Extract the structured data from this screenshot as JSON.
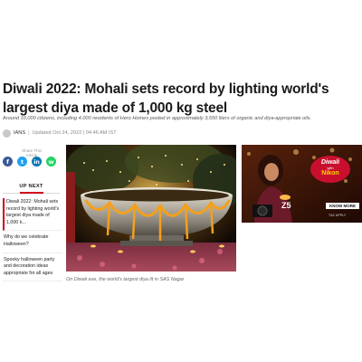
{
  "article": {
    "headline": "Diwali 2022: Mohali sets record by lighting world's largest diya made of 1,000 kg steel",
    "summary": "Around 10,000 citizens, including 4,000 residents of Hero Homes pooled in approximately 3,550 liters of organic and diya-appropriate oils.",
    "author": "IANS",
    "separator": "|",
    "updated": "Updated Oct 24, 2022 | 04:46 AM IST",
    "image_caption": "On Diwali eve, the world's largest diya lit in SAS Nagar"
  },
  "share": {
    "label": "Share This Article",
    "buttons": [
      {
        "name": "facebook",
        "glyph": "f",
        "color": "#3b5998"
      },
      {
        "name": "twitter",
        "glyph": "t",
        "color": "#1da1f2"
      },
      {
        "name": "linkedin",
        "glyph": "in",
        "color": "#0077b5"
      },
      {
        "name": "whatsapp",
        "glyph": "w",
        "color": "#25d366"
      }
    ]
  },
  "up_next": {
    "title": "UP NEXT",
    "items": [
      "Diwali 2022: Mohali sets record by lighting world's largest diya made of 1,000 k...",
      "Why do we celebrate Halloween?",
      "Spooky halloween party and decoration ideas appropriate for all ages"
    ]
  },
  "ad": {
    "brand": "Z5",
    "cta": "KNOW MORE",
    "badge_line1": "Diwali",
    "badge_line2": "Nikon",
    "badge_line3": "with",
    "footer": "T&C APPLY",
    "colors": {
      "background": "#3a1408",
      "cta": "#ffffff",
      "badge": "#c8102e"
    }
  },
  "colors": {
    "accent": "#d0021b",
    "headline": "#1a1a1a"
  }
}
